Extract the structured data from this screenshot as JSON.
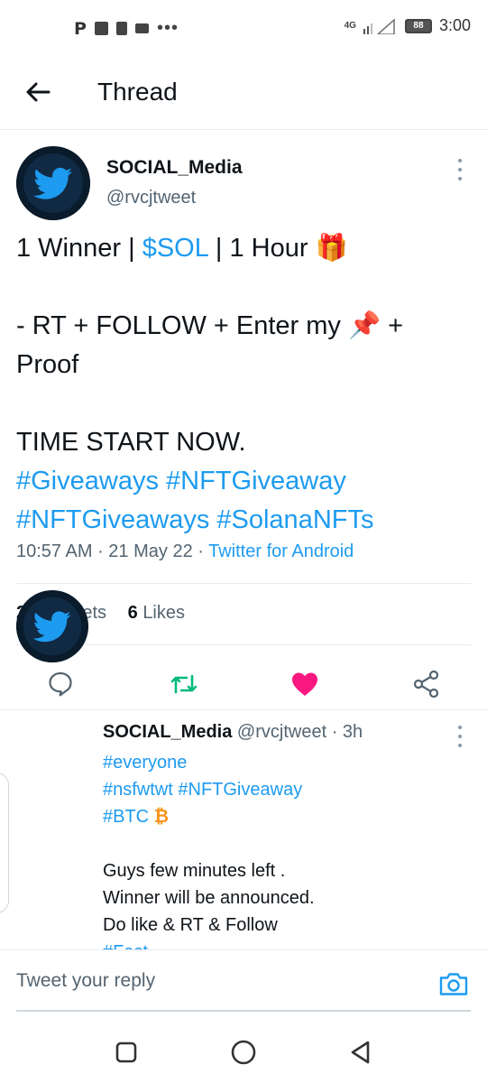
{
  "status_bar": {
    "left_icons": [
      "P",
      "portrait-icon",
      "alert-icon",
      "chat-icon",
      "..."
    ],
    "network": "4G",
    "battery": "88",
    "time": "3:00"
  },
  "header": {
    "title": "Thread"
  },
  "main_tweet": {
    "name": "SOCIAL_Media",
    "handle": "@rvcjtweet",
    "line1_pre": "1 Winner | ",
    "line1_cashtag": "$SOL",
    "line1_post": " | 1 Hour ",
    "line1_emoji": "🎁",
    "line2_pre": "- RT + FOLLOW +  Enter my ",
    "line2_emoji": "📌",
    "line2_post": " +",
    "line3": "Proof",
    "line4": "TIME START NOW.",
    "hashtag1": "#Giveaways",
    "hashtag2": "#NFTGiveaway",
    "hashtag3": "#NFTGiveaways",
    "hashtag4": "#SolanaNFTs",
    "time": "10:57 AM",
    "date": "21 May 22",
    "source": "Twitter for Android",
    "retweets_count": "2",
    "retweets_label": "Retweets",
    "likes_count": "6",
    "likes_label": "Likes",
    "liked": true,
    "colors": {
      "link": "#1d9bf0",
      "like": "#f91880",
      "retweet": "#00ba7c"
    }
  },
  "reply_tweet": {
    "name": "SOCIAL_Media",
    "handle": "@rvcjtweet",
    "age": "3h",
    "hashtag1": "#everyone",
    "hashtag2": "#nsfwtwt",
    "hashtag3": "#NFTGiveaway",
    "hashtag4": "#BTC",
    "btc_symbol": "₿",
    "line1": "Guys few minutes left .",
    "line2": "Winner will be announced.",
    "line3": "Do like & RT & Follow",
    "cut_hashtag": "#Fast"
  },
  "reply_box": {
    "placeholder": "Tweet your reply"
  },
  "icons": {
    "back": "arrow-left-icon",
    "more": "more-vertical-icon",
    "reply": "comment-icon",
    "retweet": "retweet-icon",
    "like": "heart-icon",
    "share": "share-icon",
    "camera": "camera-icon",
    "nav_recents": "square-icon",
    "nav_home": "circle-icon",
    "nav_back": "triangle-back-icon"
  }
}
